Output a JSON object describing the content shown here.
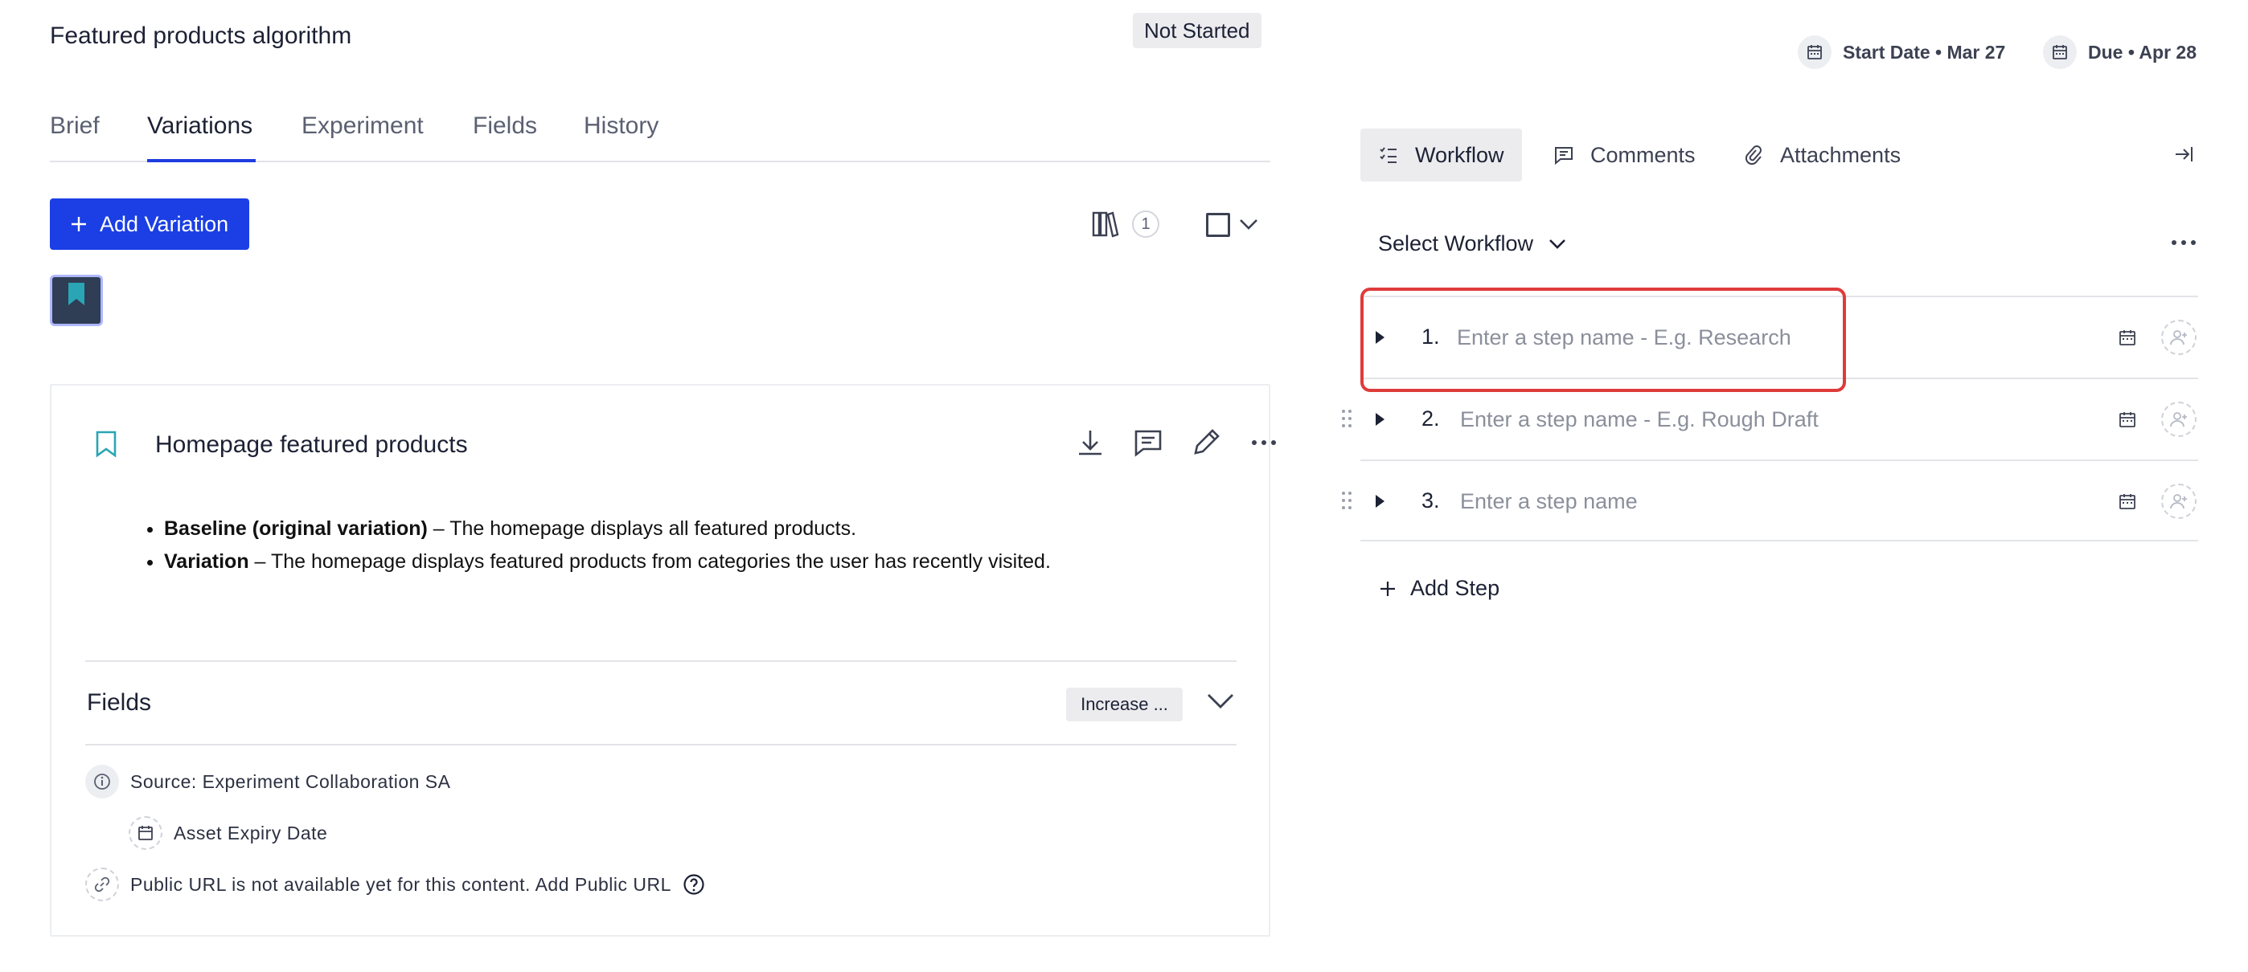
{
  "header": {
    "title": "Featured products algorithm",
    "status": "Not Started"
  },
  "tabs": [
    "Brief",
    "Variations",
    "Experiment",
    "Fields",
    "History"
  ],
  "active_tab": "Variations",
  "toolbar": {
    "add_variation_label": "Add Variation",
    "library_count": "1"
  },
  "variation": {
    "title": "Homepage featured products",
    "bullets": [
      {
        "bold": "Baseline (original variation)",
        "text": " – The homepage displays all featured products."
      },
      {
        "bold": "Variation",
        "text": " – The homepage displays featured products from categories the user has recently visited."
      }
    ]
  },
  "fields": {
    "title": "Fields",
    "tag": "Increase ...",
    "source": "Source: Experiment Collaboration SA",
    "asset_expiry": "Asset Expiry Date",
    "public_url": "Public URL is not available yet for this content. Add Public URL"
  },
  "dates": {
    "start": "Start Date • Mar 27",
    "due": "Due • Apr 28"
  },
  "right_tabs": {
    "workflow": "Workflow",
    "comments": "Comments",
    "attachments": "Attachments"
  },
  "workflow": {
    "select_label": "Select Workflow",
    "steps": [
      {
        "number": "1.",
        "value": "",
        "placeholder": "Enter a step name - E.g. Research"
      },
      {
        "number": "2.",
        "value": "",
        "placeholder": "Enter a step name - E.g. Rough Draft"
      },
      {
        "number": "3.",
        "value": "",
        "placeholder": "Enter a step name"
      }
    ],
    "add_step_label": "Add Step"
  },
  "colors": {
    "primary": "#1b3fe4",
    "highlight": "#df3b3b",
    "bookmark_teal": "#2aa5b5"
  },
  "icons": [
    "plus-icon",
    "library-icon",
    "checkbox-icon",
    "chevron-down-icon",
    "bookmark-icon",
    "download-icon",
    "comment-icon",
    "pencil-icon",
    "more-icon",
    "info-icon",
    "calendar-icon",
    "link-icon",
    "help-icon",
    "workflow-icon",
    "paperclip-icon",
    "collapse-panel-icon",
    "caret-right-icon",
    "drag-handle-icon",
    "add-user-icon"
  ]
}
